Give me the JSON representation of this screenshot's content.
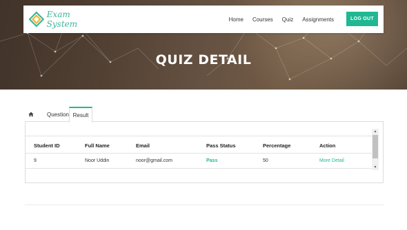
{
  "brand": {
    "name": "Exam System",
    "accent": "#20b893"
  },
  "nav": {
    "links": [
      {
        "label": "Home"
      },
      {
        "label": "Courses"
      },
      {
        "label": "Quiz"
      },
      {
        "label": "Assignments"
      }
    ],
    "logout_label": "LOG OUT"
  },
  "hero": {
    "title": "QUIZ DETAIL"
  },
  "tabs": {
    "home_icon": "home-icon",
    "items": [
      {
        "label": "Questions"
      },
      {
        "label": "Result"
      }
    ],
    "active": "Result"
  },
  "results": {
    "columns": [
      "Student ID",
      "Full Name",
      "Email",
      "Pass Status",
      "Percentage",
      "Action"
    ],
    "rows": [
      {
        "student_id": "9",
        "full_name": "Noor Uddin",
        "email": "noor@gmail.com",
        "pass_status": "Pass",
        "percentage": "50",
        "action": "More Detail"
      }
    ]
  },
  "scrollbar": {
    "up_icon": "▲",
    "down_icon": "▼"
  }
}
